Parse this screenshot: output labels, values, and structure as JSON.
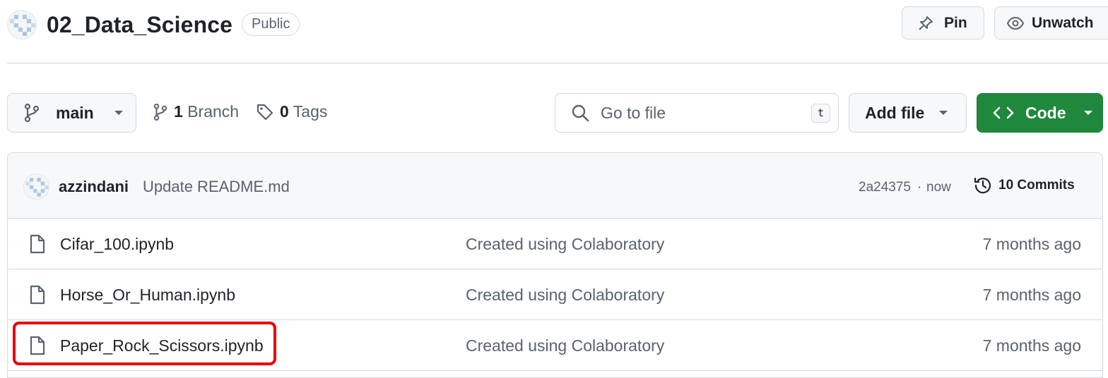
{
  "repo": {
    "name": "02_Data_Science",
    "visibility": "Public"
  },
  "header_actions": {
    "pin_label": "Pin",
    "unwatch_label": "Unwatch"
  },
  "toolbar": {
    "branch_name": "main",
    "branches_count": "1",
    "branches_label": "Branch",
    "tags_count": "0",
    "tags_label": "Tags",
    "search_placeholder": "Go to file",
    "search_shortcut": "t",
    "add_file_label": "Add file",
    "code_label": "Code"
  },
  "latest_commit": {
    "author": "azzindani",
    "message": "Update README.md",
    "hash": "2a24375",
    "separator": "·",
    "time": "now",
    "commits_count_label": "10 Commits"
  },
  "files": [
    {
      "name": "Cifar_100.ipynb",
      "message": "Created using Colaboratory",
      "date": "7 months ago"
    },
    {
      "name": "Horse_Or_Human.ipynb",
      "message": "Created using Colaboratory",
      "date": "7 months ago"
    },
    {
      "name": "Paper_Rock_Scissors.ipynb",
      "message": "Created using Colaboratory",
      "date": "7 months ago",
      "highlighted": true
    }
  ],
  "colors": {
    "accent_green": "#1f883d",
    "highlight_red": "#e8000b",
    "avatar_blue": "#a9c8e2"
  }
}
